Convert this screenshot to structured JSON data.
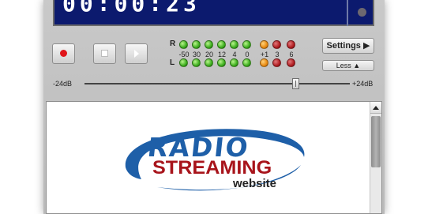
{
  "display": {
    "time": "00:00:23"
  },
  "transport": {
    "record": "record",
    "stop": "stop",
    "play": "play"
  },
  "meter": {
    "right_label": "R",
    "left_label": "L",
    "scale": [
      "-50",
      "30",
      "20",
      "12",
      "4",
      "0",
      "+1",
      "3",
      "6"
    ],
    "led_colors": {
      "green": "#3dae1f",
      "orange": "#e98a12",
      "red": "#b11e22"
    }
  },
  "buttons": {
    "settings": "Settings",
    "less": "Less"
  },
  "gain": {
    "min_label": "-24dB",
    "max_label": "+24dB"
  },
  "logo": {
    "line1": "RADIO",
    "line2": "STREAMING",
    "line3": "website",
    "colors": {
      "blue": "#1e5fa8",
      "red": "#a8141b"
    }
  }
}
